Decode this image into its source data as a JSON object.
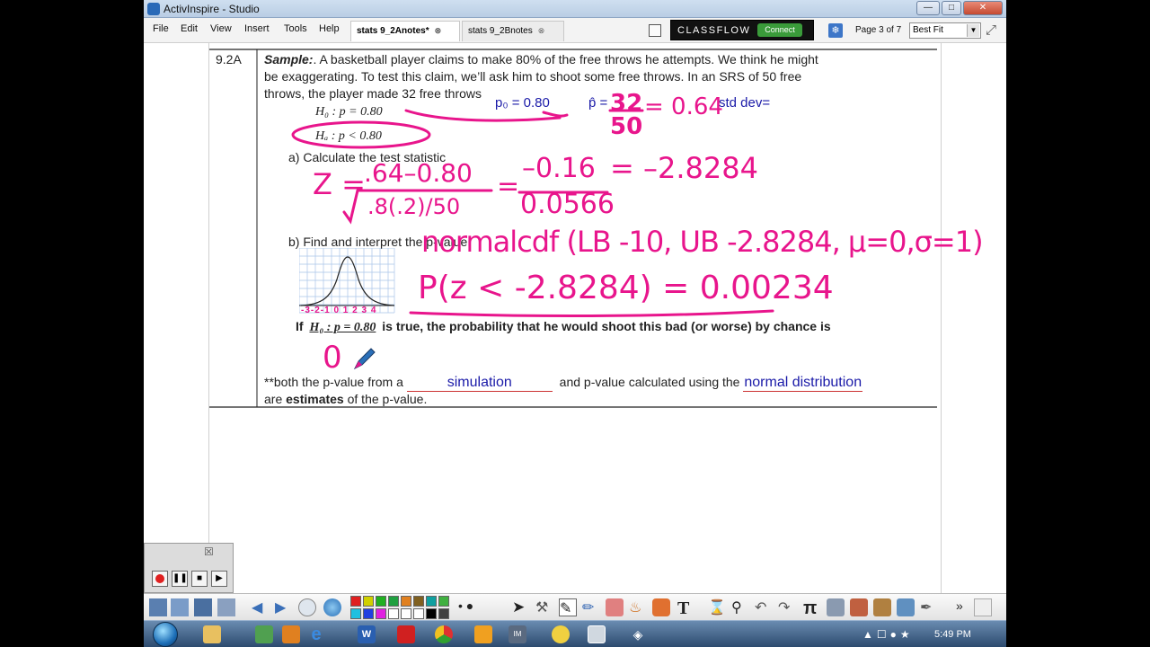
{
  "window": {
    "title": "ActivInspire - Studio"
  },
  "menu": {
    "items": [
      "File",
      "Edit",
      "View",
      "Insert",
      "Tools",
      "Help"
    ]
  },
  "tabs": [
    {
      "label": "stats 9_2Anotes*",
      "close": "⊗"
    },
    {
      "label": "stats 9_2Bnotes",
      "close": "⊗"
    }
  ],
  "classflow": {
    "brand": "CLASSFLOW",
    "connect": "Connect"
  },
  "page_indicator": "Page 3 of 7",
  "zoom": {
    "value": "Best Fit"
  },
  "document": {
    "section_id": "9.2A",
    "sample_label": "Sample:",
    "sample_text_1": ". A basketball player claims to make 80% of the free throws he attempts.  We think he might",
    "sample_text_2": "be exaggerating.  To test this claim, we’ll ask him to shoot some free throws.  In an SRS of 50 free",
    "sample_text_3": "throws, the player made 32 free throws",
    "h0": "H₀ : p = 0.80",
    "ha": "Hₐ : p < 0.80",
    "typed_p0": "p₀ = 0.80",
    "typed_phat": "p̂ =",
    "typed_stddev": "std dev=",
    "part_a": "a)   Calculate the test statistic",
    "part_b": "b)   Find and interpret the p-value",
    "interpret_if": "If",
    "interpret_h0": "H₀ : p = 0.80",
    "interpret_rest": "is true, the probability that he would shoot this bad (or worse) by chance is",
    "note_1": "**both the p-value from a",
    "note_fill_1": "simulation",
    "note_2": "and p-value calculated using the",
    "note_fill_2": "normal distribution",
    "note_3": "are",
    "note_3_bold": "estimates",
    "note_3_end": "of the p-value.",
    "axis_labels": "-3-2-1 0 1 2 3 4",
    "handwriting": {
      "phat_num": "32",
      "phat_den": "50",
      "phat_result": "= 0.64",
      "z_lhs": "Z =",
      "z_num": ".64–0.80",
      "z_den": ".8(.2)/50",
      "z_mid_num": "–0.16",
      "z_mid_den": "0.0566",
      "z_result": "= –2.8284",
      "normalcdf": "normalcdf (LB -10, UB -2.8284, μ=0,σ=1)",
      "prob": "P(z < -2.8284) = 0.00234",
      "answer": "0"
    }
  },
  "recorder": {
    "close": "☒"
  },
  "taskbar": {
    "time": "5:49 PM"
  },
  "colors": {
    "ink": "#e8158c",
    "typed_blue": "#1a1aa8",
    "classflow_green": "#3a9b3a"
  }
}
